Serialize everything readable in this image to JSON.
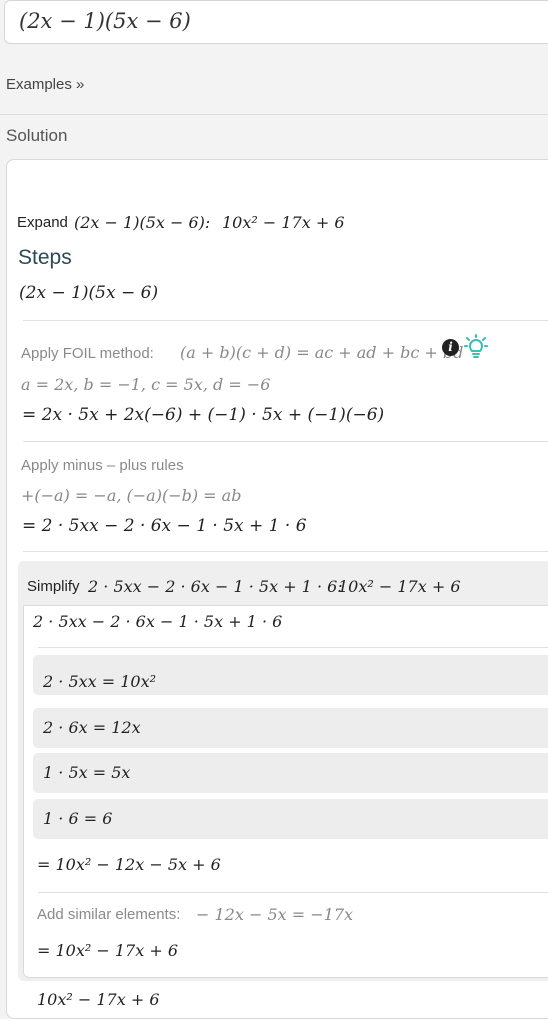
{
  "input": {
    "expression": "(2x − 1)(5x − 6)"
  },
  "examples_link": "Examples »",
  "solution_title": "Solution",
  "expand": {
    "label": "Expand",
    "expression": "(2x − 1)(5x − 6):",
    "result": "10x² − 17x + 6"
  },
  "steps_title": "Steps",
  "steps_start": "(2x − 1)(5x − 6)",
  "foil": {
    "label": "Apply FOIL method:",
    "rule": "(a + b)(c + d) = ac + ad + bc + bd",
    "vars": "a = 2x, b = −1, c = 5x, d = −6",
    "result": "= 2x · 5x + 2x(−6) + (−1) · 5x + (−1)(−6)"
  },
  "minus_plus": {
    "label": "Apply minus – plus rules",
    "rule": "+(−a) = −a,  (−a)(−b) = ab",
    "result": "= 2 · 5xx − 2 · 6x − 1 · 5x + 1 · 6"
  },
  "simplify": {
    "label": "Simplify",
    "expression": "2 · 5xx − 2 · 6x − 1 · 5x + 1 · 6:",
    "result": "10x² − 17x + 6",
    "start": "2 · 5xx − 2 · 6x − 1 · 5x + 1 · 6",
    "substeps": [
      "2 · 5xx = 10x²",
      "2 · 6x = 12x",
      "1 · 5x = 5x",
      "1 · 6 = 6"
    ],
    "after_substeps": "= 10x² − 12x − 5x + 6",
    "similar_label": "Add similar elements:",
    "similar_rule": "− 12x − 5x = −17x",
    "final": "= 10x² − 17x + 6"
  },
  "bottom_result": "10x² − 17x + 6",
  "icons": {
    "info": "info-icon",
    "hint": "lightbulb-icon"
  }
}
